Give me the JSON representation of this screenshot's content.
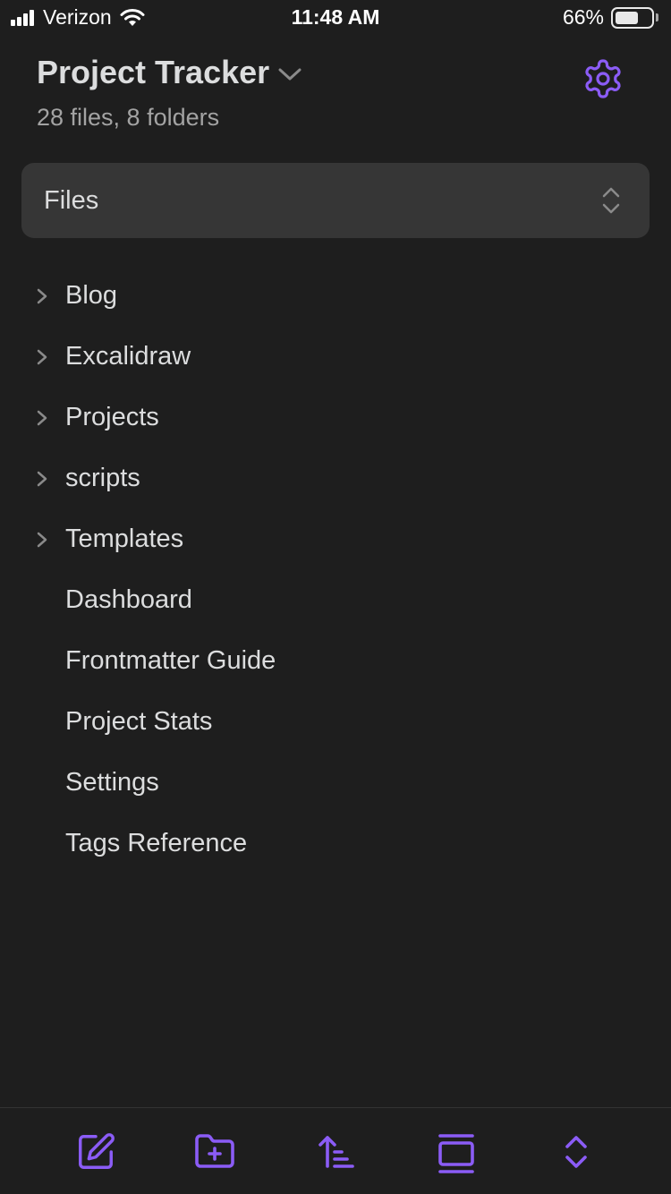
{
  "status_bar": {
    "carrier": "Verizon",
    "time": "11:48 AM",
    "battery_percent": "66%",
    "battery_level": 0.66,
    "signal_bars": 4,
    "wifi_icon": "wifi-icon"
  },
  "header": {
    "title": "Project Tracker",
    "stats": "28 files, 8 folders",
    "settings_icon": "gear-icon"
  },
  "view_selector": {
    "label": "Files",
    "icon": "chevron-up-down-icon"
  },
  "tree": {
    "items": [
      {
        "label": "Blog",
        "type": "folder"
      },
      {
        "label": "Excalidraw",
        "type": "folder"
      },
      {
        "label": "Projects",
        "type": "folder"
      },
      {
        "label": "scripts",
        "type": "folder"
      },
      {
        "label": "Templates",
        "type": "folder"
      },
      {
        "label": "Dashboard",
        "type": "file"
      },
      {
        "label": "Frontmatter Guide",
        "type": "file"
      },
      {
        "label": "Project Stats",
        "type": "file"
      },
      {
        "label": "Settings",
        "type": "file"
      },
      {
        "label": "Tags Reference",
        "type": "file"
      }
    ]
  },
  "toolbar": {
    "buttons": [
      {
        "name": "new-note-button",
        "icon": "edit-icon"
      },
      {
        "name": "new-folder-button",
        "icon": "folder-plus-icon"
      },
      {
        "name": "sort-button",
        "icon": "sort-ascending-icon"
      },
      {
        "name": "collapse-all-button",
        "icon": "gallery-icon"
      },
      {
        "name": "expand-all-button",
        "icon": "chevron-up-down-icon"
      }
    ]
  },
  "colors": {
    "background": "#1e1e1e",
    "accent": "#8b5cf6",
    "text": "#dcddde",
    "muted": "#a3a3a3",
    "selector_bg": "#363636"
  }
}
